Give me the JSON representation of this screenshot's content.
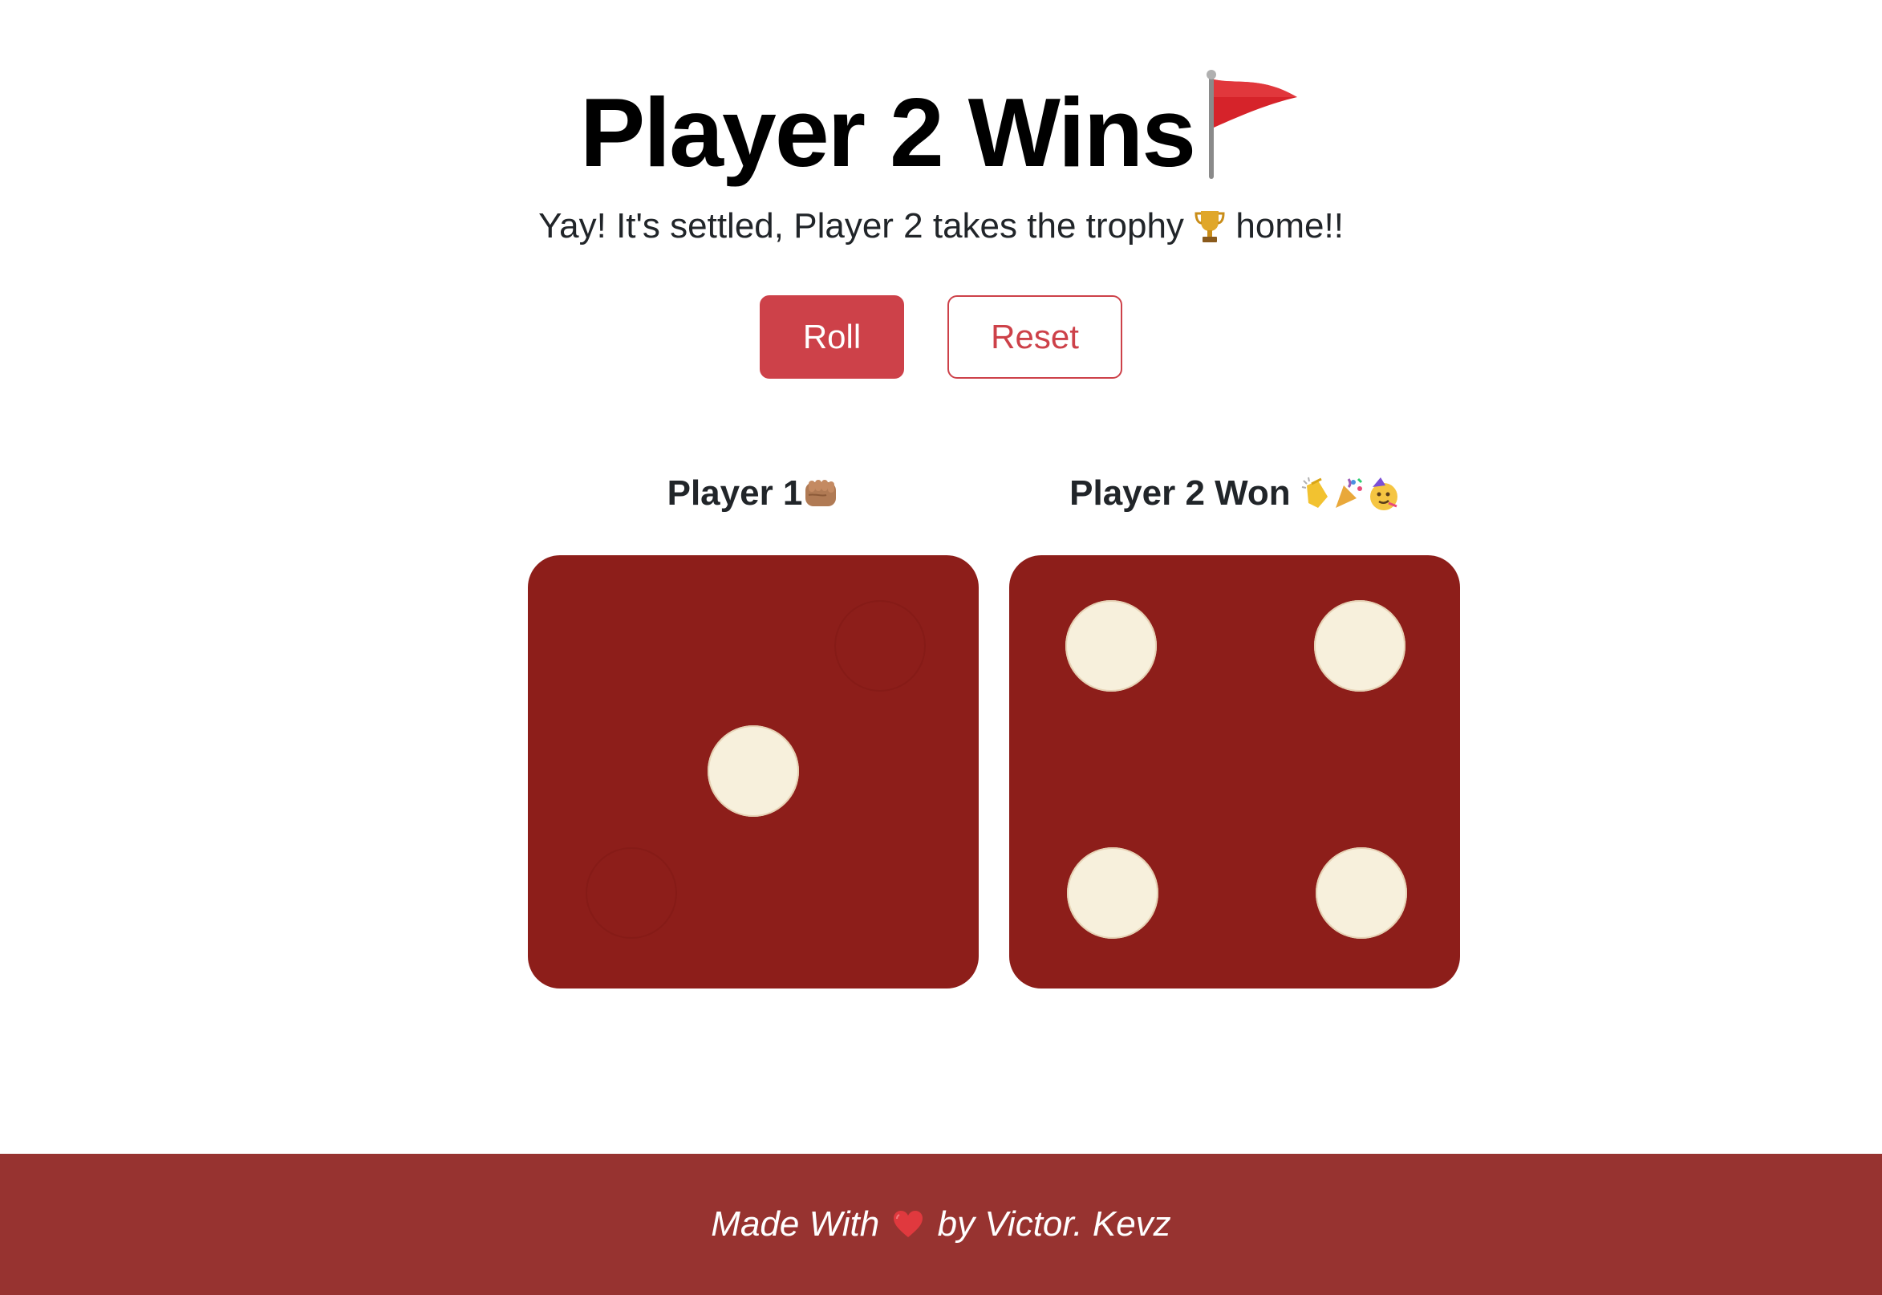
{
  "header": {
    "title": "Player 2 Wins",
    "title_icon": "flag-icon",
    "subtitle_before": "Yay! It's settled, Player 2 takes the trophy",
    "subtitle_icon": "trophy-icon",
    "subtitle_after": "home!!"
  },
  "controls": {
    "roll_label": "Roll",
    "reset_label": "Reset"
  },
  "players": [
    {
      "name": "Player 1",
      "name_icons": [
        "fist-icon"
      ],
      "die_value": 1
    },
    {
      "name": "Player 2 Won",
      "name_icons": [
        "clapping-hands-icon",
        "party-popper-icon",
        "partying-face-icon"
      ],
      "die_value": 4
    }
  ],
  "footer": {
    "text_before": "Made With",
    "icon": "heart-icon",
    "text_after": "by Victor. Kevz"
  },
  "colors": {
    "accent": "#cd4149",
    "die_face": "#8d1e1a",
    "pip": "#f7f0dc",
    "footer_bg": "#973330"
  }
}
